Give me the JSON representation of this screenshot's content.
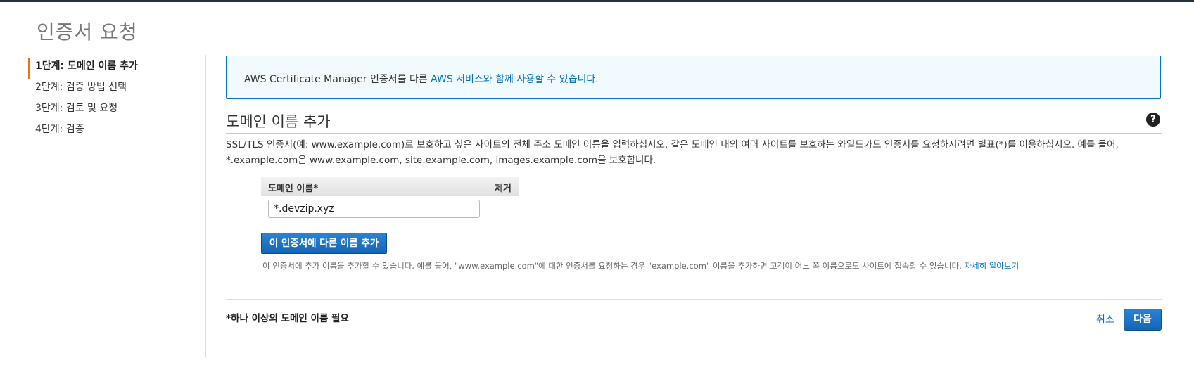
{
  "page": {
    "title": "인증서 요청"
  },
  "steps": [
    {
      "label": "1단계: 도메인 이름 추가",
      "active": true
    },
    {
      "label": "2단계: 검증 방법 선택",
      "active": false
    },
    {
      "label": "3단계: 검토 및 요청",
      "active": false
    },
    {
      "label": "4단계: 검증",
      "active": false
    }
  ],
  "info": {
    "text_before": "AWS Certificate Manager 인증서를 다른 ",
    "link_text": "AWS 서비스와 함께 사용할 수 있습니다",
    "text_after": "."
  },
  "section": {
    "title": "도메인 이름 추가",
    "help_icon": "?",
    "description": "SSL/TLS 인증서(예: www.example.com)로 보호하고 싶은 사이트의 전체 주소 도메인 이름을 입력하십시오. 같은 도메인 내의 여러 사이트를 보호하는 와일드카드 인증서를 요청하시려면 별표(*)를 이용하십시오. 예를 들어, *.example.com은 www.example.com, site.example.com, images.example.com을 보호합니다."
  },
  "table": {
    "col_domain": "도메인 이름*",
    "col_remove": "제거",
    "rows": [
      {
        "value": "*.devzip.xyz"
      }
    ]
  },
  "add_button": {
    "label": "이 인증서에 다른 이름 추가"
  },
  "hint": {
    "text": "이 인증서에 추가 이름을 추가할 수 있습니다. 예를 들어, \"www.example.com\"에 대한 인증서를 요청하는 경우 \"example.com\" 이름을 추가하면 고객이 어느 쪽 이름으로도 사이트에 접속할 수 있습니다. ",
    "link_text": "자세히 알아보기"
  },
  "footer": {
    "required_note": "*하나 이상의 도메인 이름 필요",
    "cancel_label": "취소",
    "next_label": "다음"
  },
  "colors": {
    "accent_step": "#ec7211",
    "link": "#0073bb",
    "primary_button": "#1a6fc4",
    "info_border": "#0073bb",
    "info_bg": "#f1faff"
  }
}
